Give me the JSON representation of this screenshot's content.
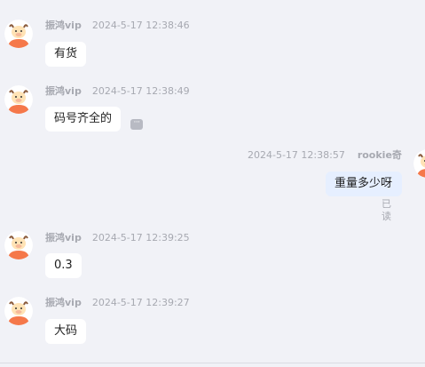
{
  "messages": [
    {
      "sender": "振鸿vip",
      "time": "2024-5-17 12:38:46",
      "text": "有货"
    },
    {
      "sender": "振鸿vip",
      "time": "2024-5-17 12:38:49",
      "text": "码号齐全的",
      "more": "···"
    },
    {
      "sender": "rookie奇",
      "time": "2024-5-17 12:38:57",
      "text": "重量多少呀",
      "status": "已读"
    },
    {
      "sender": "振鸿vip",
      "time": "2024-5-17 12:39:25",
      "text": "0.3"
    },
    {
      "sender": "振鸿vip",
      "time": "2024-5-17 12:39:27",
      "text": "大码"
    }
  ],
  "colors": {
    "background": "#f1f2f7",
    "bubble_other": "#ffffff",
    "bubble_self": "#e6efff",
    "meta_text": "#a7a9b1",
    "avatar_body": "#f5784a",
    "avatar_face": "#ffe3b5"
  },
  "icons": {
    "avatar": "cartoon-bull-avatar-icon",
    "more": "more-options-icon"
  }
}
